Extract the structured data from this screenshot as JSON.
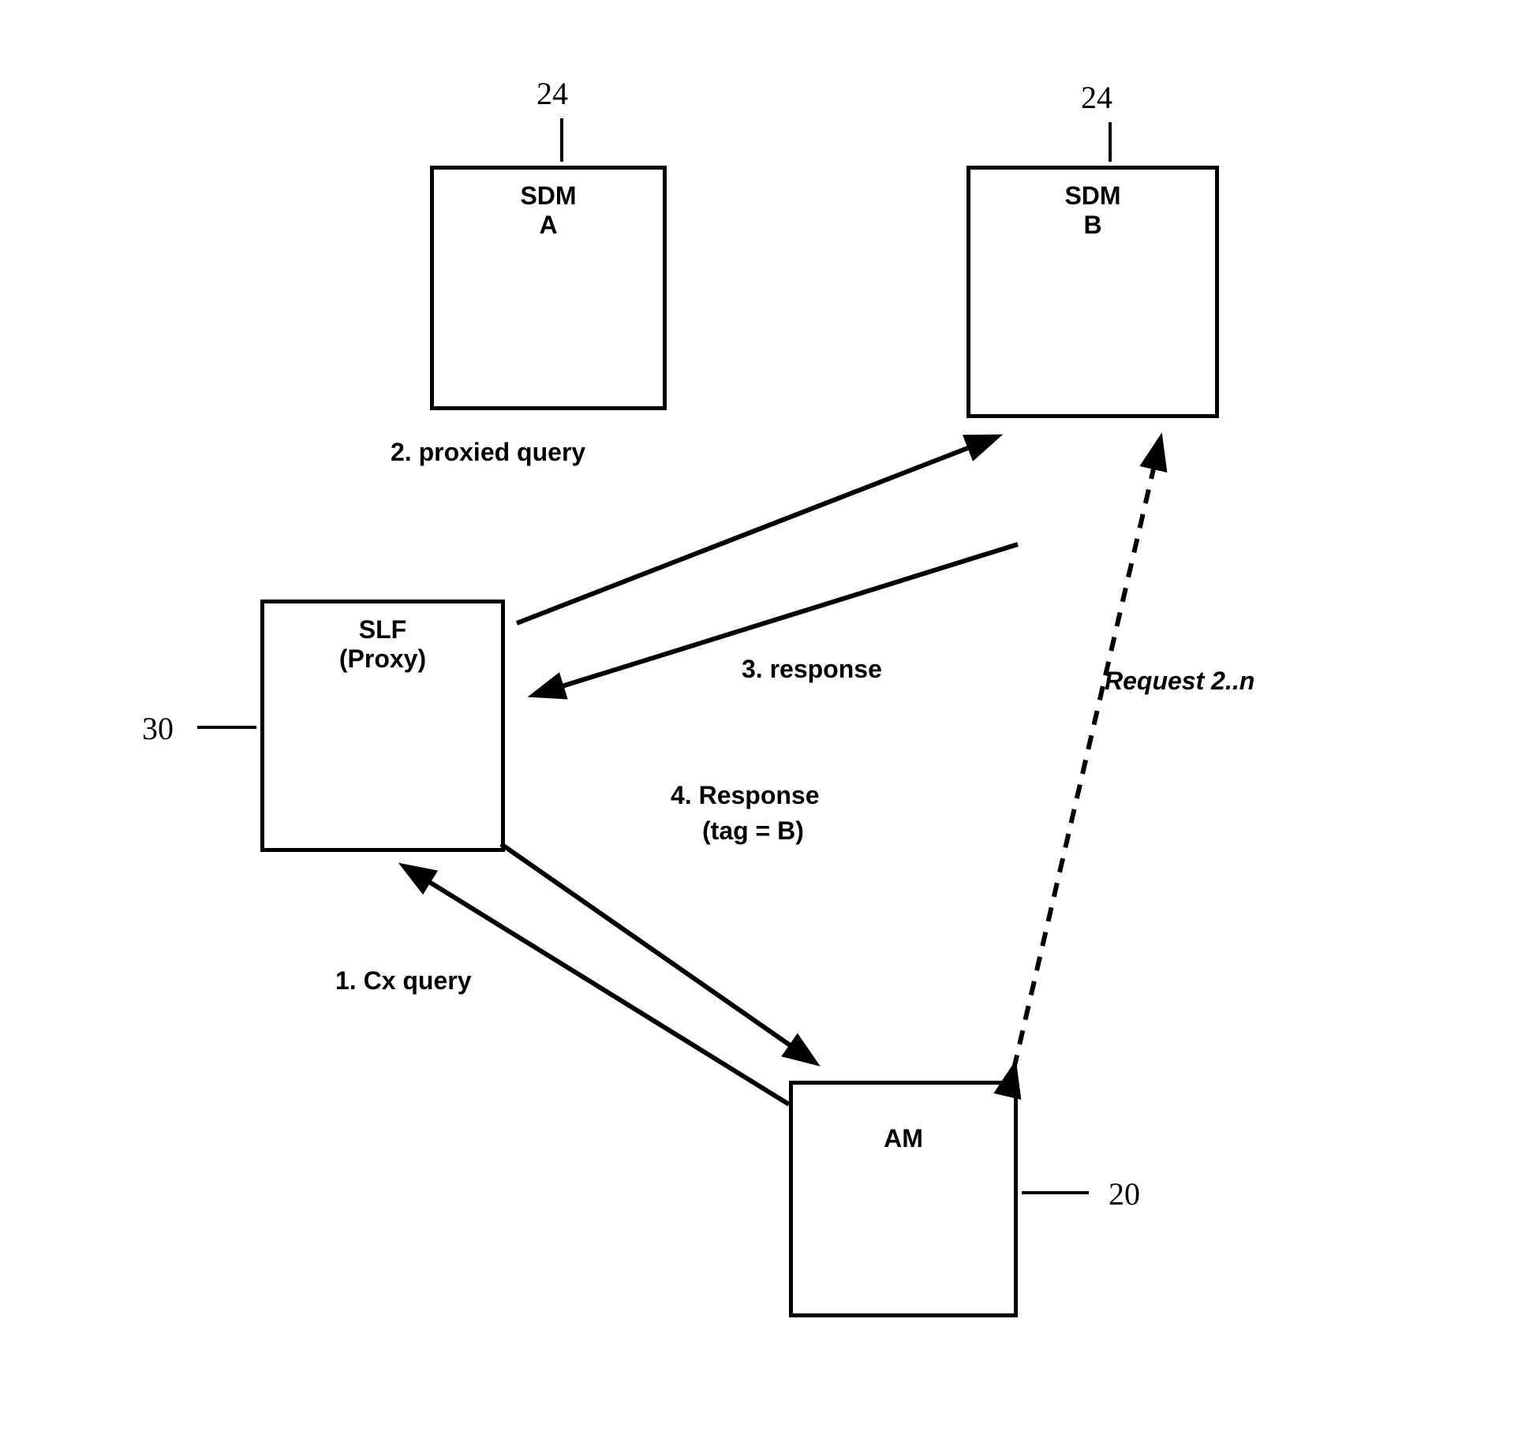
{
  "boxes": {
    "sdm_a": {
      "line1": "SDM",
      "line2": "A",
      "ref": "24"
    },
    "sdm_b": {
      "line1": "SDM",
      "line2": "B",
      "ref": "24"
    },
    "slf": {
      "line1": "SLF",
      "line2": "(Proxy)",
      "ref": "30"
    },
    "am": {
      "line1": "AM",
      "ref": "20"
    }
  },
  "labels": {
    "step1": "1. Cx query",
    "step2": "2. proxied query",
    "step3": "3. response",
    "step4a": "4. Response",
    "step4b": "(tag = B)",
    "request": "Request 2..n"
  }
}
